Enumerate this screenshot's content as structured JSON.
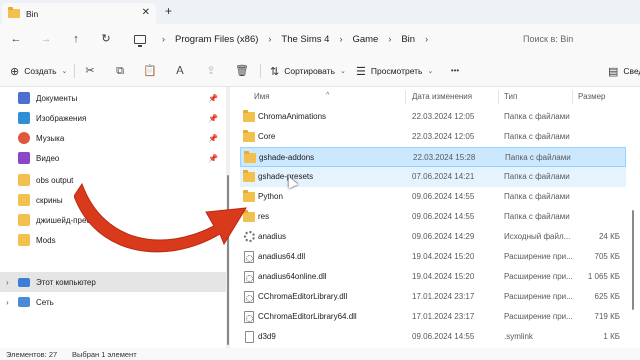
{
  "window": {
    "tab_title": "Bin",
    "tab_close_glyph": "✕",
    "new_tab_glyph": "+"
  },
  "nav": {
    "back_glyph": "←",
    "forward_glyph": "→",
    "up_glyph": "↑",
    "refresh_glyph": "↻",
    "crumb_sep": "›",
    "breadcrumbs": [
      "Program Files (x86)",
      "The Sims 4",
      "Game",
      "Bin"
    ],
    "search_placeholder": "Поиск в: Bin"
  },
  "toolbar": {
    "create_label": "Создать",
    "create_glyph": "⊕",
    "chevron": "⌄",
    "cut_glyph": "✂",
    "copy_glyph": "⧉",
    "paste_glyph": "📋",
    "rename_glyph": "Ａ",
    "share_glyph": "⇪",
    "delete_glyph": "🗑",
    "sort_label": "Сортировать",
    "sort_glyph": "⇅",
    "view_label": "Просмотреть",
    "view_glyph": "☰",
    "more_glyph": "•••",
    "details_label": "Сведения",
    "details_glyph": "▤"
  },
  "sidebar": {
    "pin_glyph": "📌",
    "expand_glyph": "›",
    "items": [
      {
        "label": "Документы",
        "icon": "documents-icon",
        "color": "#4a6fd0",
        "pinned": true
      },
      {
        "label": "Изображения",
        "icon": "pictures-icon",
        "color": "#2f8fd6",
        "pinned": true
      },
      {
        "label": "Музыка",
        "icon": "music-icon",
        "color": "#e0573b",
        "pinned": true
      },
      {
        "label": "Видео",
        "icon": "video-icon",
        "color": "#8b45c7",
        "pinned": true
      },
      {
        "label": "obs output",
        "icon": "folder-icon",
        "color": "#f2c04d",
        "pinned": false
      },
      {
        "label": "скрины",
        "icon": "folder-icon",
        "color": "#f2c04d",
        "pinned": false
      },
      {
        "label": "джишейд-пресеты",
        "icon": "folder-icon",
        "color": "#f2c04d",
        "pinned": false
      },
      {
        "label": "Mods",
        "icon": "folder-icon",
        "color": "#f2c04d",
        "pinned": false
      }
    ],
    "this_pc": "Этот компьютер",
    "network": "Сеть"
  },
  "columns": {
    "name": "Имя",
    "date": "Дата изменения",
    "type": "Тип",
    "size": "Размер",
    "sort_caret": "^"
  },
  "files": [
    {
      "name": "ChromaAnimations",
      "date": "22.03.2024 12:05",
      "type": "Папка с файлами",
      "size": "",
      "kind": "folder",
      "state": ""
    },
    {
      "name": "Core",
      "date": "22.03.2024 12:05",
      "type": "Папка с файлами",
      "size": "",
      "kind": "folder",
      "state": ""
    },
    {
      "name": "gshade-addons",
      "date": "22.03.2024 15:28",
      "type": "Папка с файлами",
      "size": "",
      "kind": "folder",
      "state": "selected"
    },
    {
      "name": "gshade-presets",
      "date": "07.06.2024 14:21",
      "type": "Папка с файлами",
      "size": "",
      "kind": "folder",
      "state": "hover"
    },
    {
      "name": "Python",
      "date": "09.06.2024 14:55",
      "type": "Папка с файлами",
      "size": "",
      "kind": "folder",
      "state": ""
    },
    {
      "name": "res",
      "date": "09.06.2024 14:55",
      "type": "Папка с файлами",
      "size": "",
      "kind": "folder",
      "state": ""
    },
    {
      "name": "anadius",
      "date": "09.06.2024 14:29",
      "type": "Исходный файл...",
      "size": "24 КБ",
      "kind": "gear",
      "state": ""
    },
    {
      "name": "anadius64.dll",
      "date": "19.04.2024 15:20",
      "type": "Расширение при...",
      "size": "705 КБ",
      "kind": "dll",
      "state": ""
    },
    {
      "name": "anadius64online.dll",
      "date": "19.04.2024 15:20",
      "type": "Расширение при...",
      "size": "1 065 КБ",
      "kind": "dll",
      "state": ""
    },
    {
      "name": "CChromaEditorLibrary.dll",
      "date": "17.01.2024 23:17",
      "type": "Расширение при...",
      "size": "625 КБ",
      "kind": "dll",
      "state": ""
    },
    {
      "name": "CChromaEditorLibrary64.dll",
      "date": "17.01.2024 23:17",
      "type": "Расширение при...",
      "size": "719 КБ",
      "kind": "dll",
      "state": ""
    },
    {
      "name": "d3d9",
      "date": "09.06.2024 14:55",
      "type": ".symlink",
      "size": "1 КБ",
      "kind": "file",
      "state": ""
    }
  ],
  "status": {
    "items_count": "Элементов: 27",
    "selected": "Выбран 1 элемент"
  },
  "colors": {
    "accent": "#0067c0",
    "selection": "#cce8ff",
    "folder": "#f2c04d",
    "arrow": "#d93a1c"
  }
}
